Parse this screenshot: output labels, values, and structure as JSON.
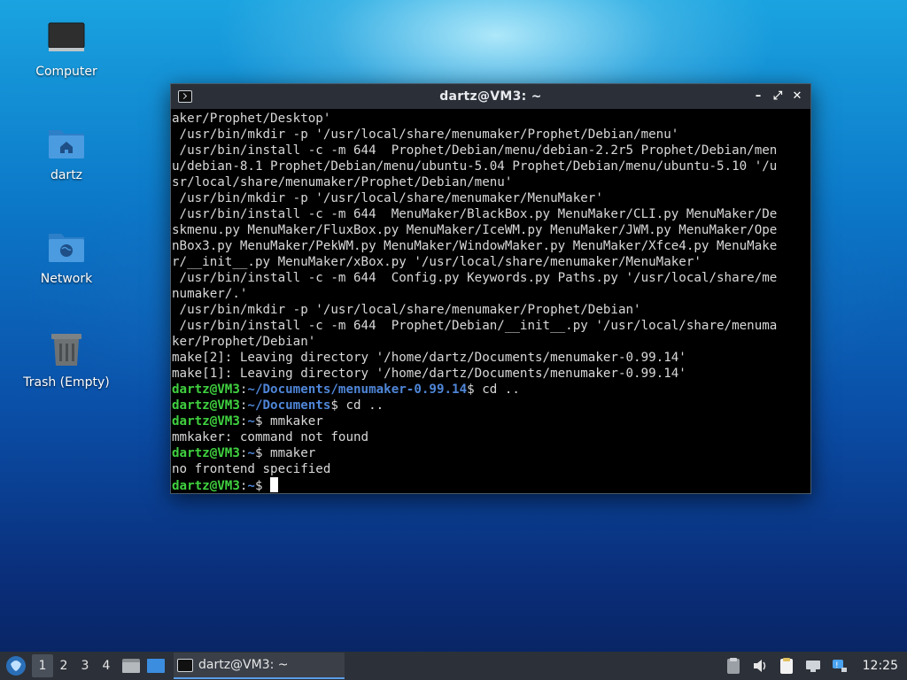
{
  "desktop": {
    "icons": [
      {
        "label": "Computer"
      },
      {
        "label": "dartz"
      },
      {
        "label": "Network"
      },
      {
        "label": "Trash (Empty)"
      }
    ]
  },
  "window": {
    "title": "dartz@VM3: ~",
    "controls": {
      "minimize": "–",
      "maximize": "⤢",
      "close": "✕"
    }
  },
  "terminal": {
    "lines": [
      "aker/Prophet/Desktop'",
      " /usr/bin/mkdir -p '/usr/local/share/menumaker/Prophet/Debian/menu'",
      " /usr/bin/install -c -m 644  Prophet/Debian/menu/debian-2.2r5 Prophet/Debian/men",
      "u/debian-8.1 Prophet/Debian/menu/ubuntu-5.04 Prophet/Debian/menu/ubuntu-5.10 '/u",
      "sr/local/share/menumaker/Prophet/Debian/menu'",
      " /usr/bin/mkdir -p '/usr/local/share/menumaker/MenuMaker'",
      " /usr/bin/install -c -m 644  MenuMaker/BlackBox.py MenuMaker/CLI.py MenuMaker/De",
      "skmenu.py MenuMaker/FluxBox.py MenuMaker/IceWM.py MenuMaker/JWM.py MenuMaker/Ope",
      "nBox3.py MenuMaker/PekWM.py MenuMaker/WindowMaker.py MenuMaker/Xfce4.py MenuMake",
      "r/__init__.py MenuMaker/xBox.py '/usr/local/share/menumaker/MenuMaker'",
      " /usr/bin/install -c -m 644  Config.py Keywords.py Paths.py '/usr/local/share/me",
      "numaker/.'",
      " /usr/bin/mkdir -p '/usr/local/share/menumaker/Prophet/Debian'",
      " /usr/bin/install -c -m 644  Prophet/Debian/__init__.py '/usr/local/share/menuma",
      "ker/Prophet/Debian'",
      "make[2]: Leaving directory '/home/dartz/Documents/menumaker-0.99.14'",
      "make[1]: Leaving directory '/home/dartz/Documents/menumaker-0.99.14'"
    ],
    "prompts": [
      {
        "user": "dartz@VM3",
        "sep": ":",
        "path": "~/Documents/menumaker-0.99.14",
        "cmd": "$ cd .."
      },
      {
        "user": "dartz@VM3",
        "sep": ":",
        "path": "~/Documents",
        "cmd": "$ cd .."
      },
      {
        "user": "dartz@VM3",
        "sep": ":",
        "path": "~",
        "cmd": "$ mmkaker"
      },
      {
        "output": "mmkaker: command not found"
      },
      {
        "user": "dartz@VM3",
        "sep": ":",
        "path": "~",
        "cmd": "$ mmaker"
      },
      {
        "output": "no frontend specified"
      },
      {
        "user": "dartz@VM3",
        "sep": ":",
        "path": "~",
        "cmd": "$ "
      }
    ]
  },
  "taskbar": {
    "workspaces": [
      "1",
      "2",
      "3",
      "4"
    ],
    "active_workspace": "1",
    "task_label": "dartz@VM3: ~",
    "clock": "12:25"
  }
}
